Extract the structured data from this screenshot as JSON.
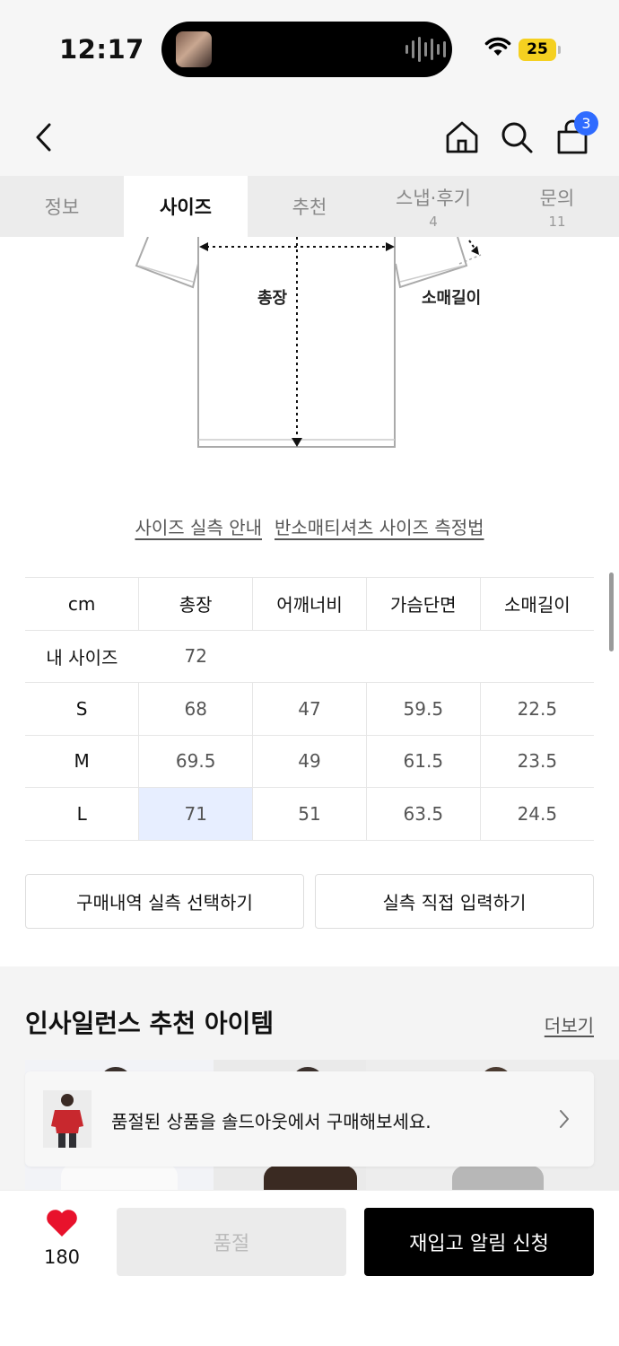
{
  "status_bar": {
    "time": "12:17",
    "battery": "25"
  },
  "header": {
    "cart_count": "3"
  },
  "tabs": [
    {
      "label": "정보",
      "count": ""
    },
    {
      "label": "사이즈",
      "count": ""
    },
    {
      "label": "추천",
      "count": ""
    },
    {
      "label": "스냅·후기",
      "count": "4"
    },
    {
      "label": "문의",
      "count": "11"
    }
  ],
  "diagram": {
    "label_length": "총장",
    "label_sleeve": "소매길이"
  },
  "links": {
    "measure_guide": "사이즈 실측 안내",
    "method": "반소매티셔츠 사이즈 측정법"
  },
  "size_table": {
    "unit": "cm",
    "columns": [
      "총장",
      "어깨너비",
      "가슴단면",
      "소매길이"
    ],
    "my_size": {
      "label": "내 사이즈",
      "values": [
        "72",
        "",
        "",
        ""
      ]
    },
    "rows": [
      {
        "size": "S",
        "values": [
          "68",
          "47",
          "59.5",
          "22.5"
        ]
      },
      {
        "size": "M",
        "values": [
          "69.5",
          "49",
          "61.5",
          "23.5"
        ]
      },
      {
        "size": "L",
        "values": [
          "71",
          "51",
          "63.5",
          "24.5"
        ]
      }
    ]
  },
  "actions": {
    "purchase_history": "구매내역 실측 선택하기",
    "manual_input": "실측 직접 입력하기"
  },
  "recommend": {
    "title": "인사일런스 추천 아이템",
    "more": "더보기"
  },
  "toast": {
    "text": "품절된 상품을 솔드아웃에서 구매해보세요."
  },
  "bottom": {
    "likes": "180",
    "soldout_label": "품절",
    "restock_label": "재입고 알림 신청"
  },
  "colors": {
    "accent": "#2f6bff",
    "highlight": "#e7eeff",
    "like": "#e8122c"
  }
}
